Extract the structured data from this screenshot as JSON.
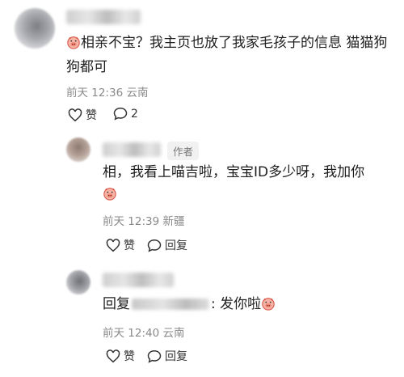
{
  "comments": [
    {
      "text_before_emoji": "",
      "text": "相亲不宝？我主页也放了我家毛孩子的信息 猫猫狗狗都可",
      "time": "前天 12:36",
      "location": "云南",
      "like_label": "赞",
      "reply_count": "2"
    }
  ],
  "replies": [
    {
      "author_badge": "作者",
      "text": "相，我看上喵吉啦，宝宝ID多少呀，我加你",
      "time": "前天 12:39",
      "location": "新疆",
      "like_label": "赞",
      "reply_label": "回复"
    },
    {
      "prefix": "回复",
      "suffix": ": 发你啦",
      "time": "前天 12:40",
      "location": "云南",
      "like_label": "赞",
      "reply_label": "回复"
    }
  ],
  "icons": {
    "emoji": "pig-face-emoji",
    "like": "heart-outline-icon",
    "comment": "speech-bubble-icon"
  },
  "colors": {
    "meta": "#8a8a8a",
    "text": "#1e1e1e",
    "emoji": "#f4a59a"
  }
}
